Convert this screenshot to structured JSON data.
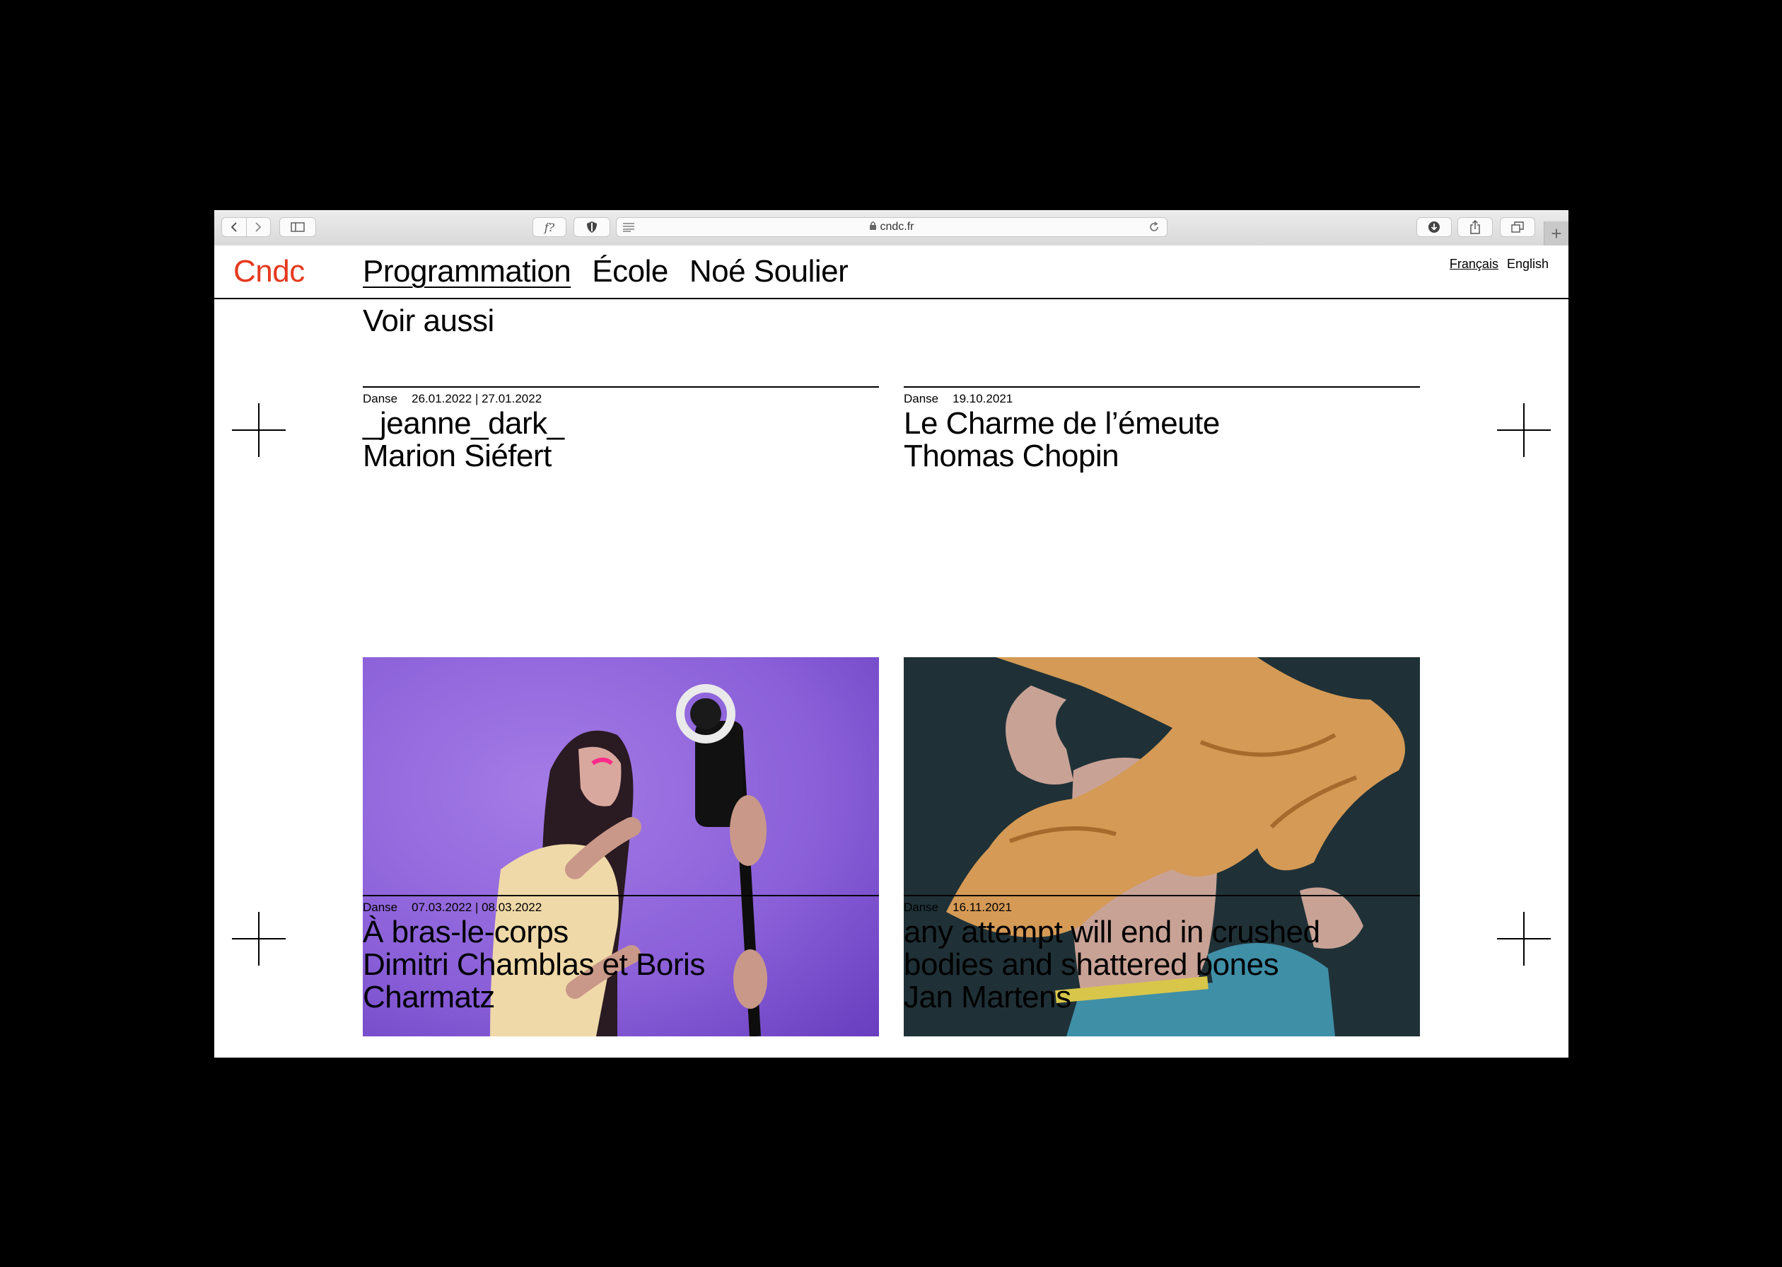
{
  "browser": {
    "url": "cndc.fr",
    "font_button_label": "f?"
  },
  "site": {
    "logo": "Cndc",
    "logo_color": "#e5391e",
    "nav": [
      {
        "label": "Programmation",
        "active": true
      },
      {
        "label": "École",
        "active": false
      },
      {
        "label": "Noé Soulier",
        "active": false
      }
    ],
    "languages": [
      {
        "label": "Français",
        "active": true
      },
      {
        "label": "English",
        "active": false
      }
    ]
  },
  "section_title": "Voir aussi",
  "cards": [
    {
      "category": "Danse",
      "date": "26.01.2022 | 27.01.2022",
      "title": "_jeanne_dark_",
      "artist": "Marion Siéfert",
      "image": "woman-with-ring-light-microphone-purple-background"
    },
    {
      "category": "Danse",
      "date": "19.10.2021",
      "title": "Le Charme de l’émeute",
      "artist": "Thomas Chopin",
      "image": "dancer-with-orange-fabric-and-mask"
    },
    {
      "category": "Danse",
      "date": "07.03.2022 | 08.03.2022",
      "title_lines": [
        "À bras-le-corps",
        "Dimitri Chamblas et Boris",
        "Charmatz"
      ],
      "image": "black-image-cropped"
    },
    {
      "category": "Danse",
      "date": "16.11.2021",
      "title_lines": [
        "any attempt will end in crushed",
        "bodies and shattered bones",
        "Jan Martens"
      ],
      "image": "grey-image-cropped"
    }
  ]
}
